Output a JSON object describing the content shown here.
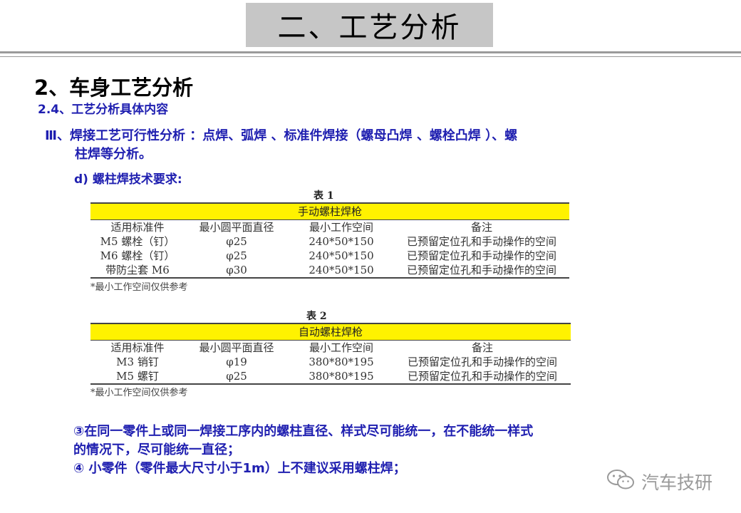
{
  "header": {
    "title": "二、工艺分析"
  },
  "section": {
    "heading": "2、车身工艺分析",
    "subheading": "2.4、工艺分析具体内容",
    "point3_line1": "Ⅲ、焊接工艺可行性分析 ：点焊、弧焊 、标准件焊接（螺母凸焊 、螺栓凸焊 ）、螺",
    "point3_line2": "柱焊等分析。",
    "requirement": "d) 螺柱焊技术要求:"
  },
  "table1": {
    "caption": "表 1",
    "header": "手动螺柱焊枪",
    "columns": [
      "适用标准件",
      "最小圆平面直径",
      "最小工作空间",
      "备注"
    ],
    "rows": [
      [
        "M5 螺栓（钉）",
        "φ25",
        "240*50*150",
        "已预留定位孔和手动操作的空间"
      ],
      [
        "M6 螺栓（钉）",
        "φ25",
        "240*50*150",
        "已预留定位孔和手动操作的空间"
      ],
      [
        "带防尘套 M6",
        "φ30",
        "240*50*150",
        "已预留定位孔和手动操作的空间"
      ]
    ],
    "note": "*最小工作空间仅供参考"
  },
  "table2": {
    "caption": "表 2",
    "header": "自动螺柱焊枪",
    "columns": [
      "适用标准件",
      "最小圆平面直径",
      "最小工作空间",
      "备注"
    ],
    "rows": [
      [
        "M3 销钉",
        "φ19",
        "380*80*195",
        "已预留定位孔和手动操作的空间"
      ],
      [
        "M5 螺钉",
        "φ25",
        "380*80*195",
        "已预留定位孔和手动操作的空间"
      ]
    ],
    "note": "*最小工作空间仅供参考"
  },
  "notes": {
    "item3_line1": "③在同一零件上或同一焊接工序内的螺柱直径、样式尽可能统一，在不能统一样式",
    "item3_line2": "的情况下，尽可能统一直径；",
    "item4": "④ 小零件（零件最大尺寸小于1m）上不建议采用螺柱焊；"
  },
  "watermark": {
    "text": "汽车技研",
    "icon": "wechat-icon"
  },
  "colors": {
    "body_text": "#1f1fb0",
    "table_header": "#fff200",
    "title_box": "#c6c6c6"
  }
}
